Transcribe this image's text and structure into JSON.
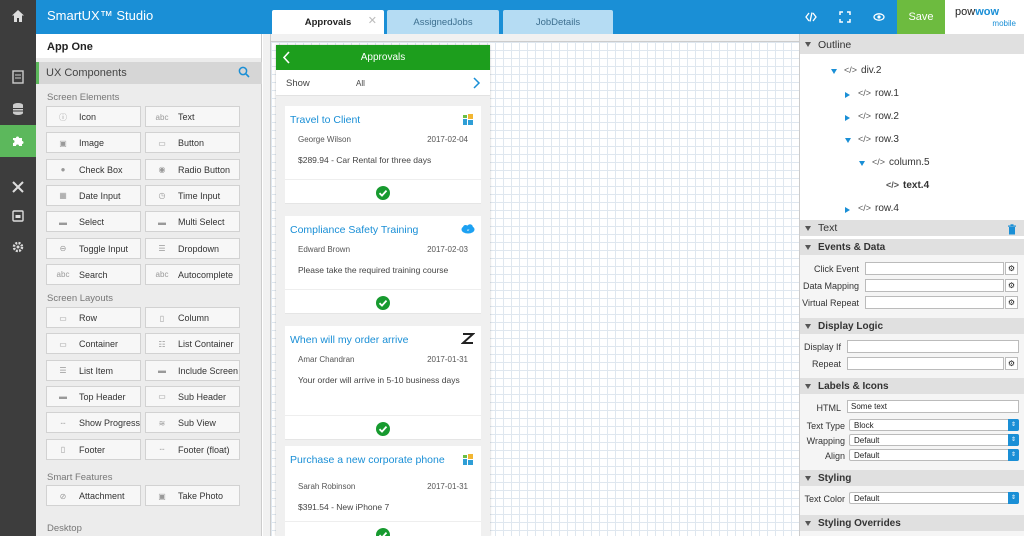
{
  "app": {
    "title": "SmartUX™ Studio",
    "project": "App One",
    "save_label": "Save",
    "brand_a": "pow",
    "brand_b": "wow",
    "brand_c": "mobile"
  },
  "tabs": [
    {
      "label": "Approvals",
      "active": true,
      "close": "✕"
    },
    {
      "label": "AssignedJobs",
      "active": false
    },
    {
      "label": "JobDetails",
      "active": false
    }
  ],
  "ux_components": {
    "header": "UX Components",
    "sections": {
      "elements": "Screen Elements",
      "layouts": "Screen Layouts",
      "smart": "Smart Features",
      "desktop": "Desktop"
    },
    "elements": [
      {
        "label": "Icon",
        "icon": "info-icon"
      },
      {
        "label": "Text",
        "icon": "text-icon"
      },
      {
        "label": "Image",
        "icon": "image-icon"
      },
      {
        "label": "Button",
        "icon": "button-icon"
      },
      {
        "label": "Check Box",
        "icon": "checkbox-icon"
      },
      {
        "label": "Radio Button",
        "icon": "radio-icon"
      },
      {
        "label": "Date Input",
        "icon": "calendar-icon"
      },
      {
        "label": "Time Input",
        "icon": "clock-icon"
      },
      {
        "label": "Select",
        "icon": "select-icon"
      },
      {
        "label": "Multi Select",
        "icon": "multi-select-icon"
      },
      {
        "label": "Toggle Input",
        "icon": "toggle-icon"
      },
      {
        "label": "Dropdown",
        "icon": "dropdown-icon"
      },
      {
        "label": "Search",
        "icon": "search-field-icon"
      },
      {
        "label": "Autocomplete",
        "icon": "autocomplete-icon"
      }
    ],
    "layouts": [
      {
        "label": "Row",
        "icon": "row-icon"
      },
      {
        "label": "Column",
        "icon": "column-icon"
      },
      {
        "label": "Container",
        "icon": "container-icon"
      },
      {
        "label": "List Container",
        "icon": "list-container-icon"
      },
      {
        "label": "List Item",
        "icon": "list-item-icon"
      },
      {
        "label": "Include Screen",
        "icon": "include-screen-icon"
      },
      {
        "label": "Top Header",
        "icon": "top-header-icon"
      },
      {
        "label": "Sub Header",
        "icon": "sub-header-icon"
      },
      {
        "label": "Show Progress",
        "icon": "progress-icon"
      },
      {
        "label": "Sub View",
        "icon": "layers-icon"
      },
      {
        "label": "Footer",
        "icon": "footer-icon"
      },
      {
        "label": "Footer (float)",
        "icon": "footer-float-icon"
      }
    ],
    "smart": [
      {
        "label": "Attachment",
        "icon": "paperclip-icon"
      },
      {
        "label": "Take Photo",
        "icon": "photo-icon"
      }
    ]
  },
  "phone": {
    "header": "Approvals",
    "show_label": "Show",
    "show_value": "All",
    "cards": [
      {
        "title": "Travel to Client",
        "name": "George Wilson",
        "date": "2017-02-04",
        "desc": "$289.94 - Car Rental for three days",
        "logo": "sharepoint-logo-icon"
      },
      {
        "title": "Compliance Safety Training",
        "name": "Edward Brown",
        "date": "2017-02-03",
        "desc": "Please take the required training course",
        "logo": "salesforce-logo-icon"
      },
      {
        "title": "When will my order arrive",
        "name": "Amar Chandran",
        "date": "2017-01-31",
        "desc": "Your order will arrive in 5-10 business days",
        "logo": "zendesk-logo-icon"
      },
      {
        "title": "Purchase a new corporate phone",
        "name": "Sarah Robinson",
        "date": "2017-01-31",
        "desc": "$391.54 - New iPhone 7",
        "logo": "sharepoint-logo-icon"
      }
    ]
  },
  "outline": {
    "header": "Outline",
    "nodes": [
      {
        "label": "div.2"
      },
      {
        "label": "row.1"
      },
      {
        "label": "row.2"
      },
      {
        "label": "row.3"
      },
      {
        "label": "column.5"
      },
      {
        "label": "text.4"
      },
      {
        "label": "row.4"
      }
    ]
  },
  "properties": {
    "header": "Text",
    "events_header": "Events & Data",
    "click_event": "Click Event",
    "data_mapping": "Data Mapping",
    "virtual_repeat": "Virtual Repeat",
    "display_logic_header": "Display Logic",
    "display_if": "Display If",
    "repeat": "Repeat",
    "labels_header": "Labels & Icons",
    "html_label": "HTML",
    "html_value": "Some text",
    "text_type_label": "Text Type",
    "text_type_value": "Block",
    "wrapping_label": "Wrapping",
    "wrapping_value": "Default",
    "align_label": "Align",
    "align_value": "Default",
    "styling_header": "Styling",
    "text_color_label": "Text Color",
    "text_color_value": "Default",
    "overrides_header": "Styling Overrides"
  },
  "colors": {
    "accent": "#1a8fd6",
    "green": "#1d9e1d",
    "save": "#6dbb3f",
    "rail": "#3d3d3d"
  }
}
